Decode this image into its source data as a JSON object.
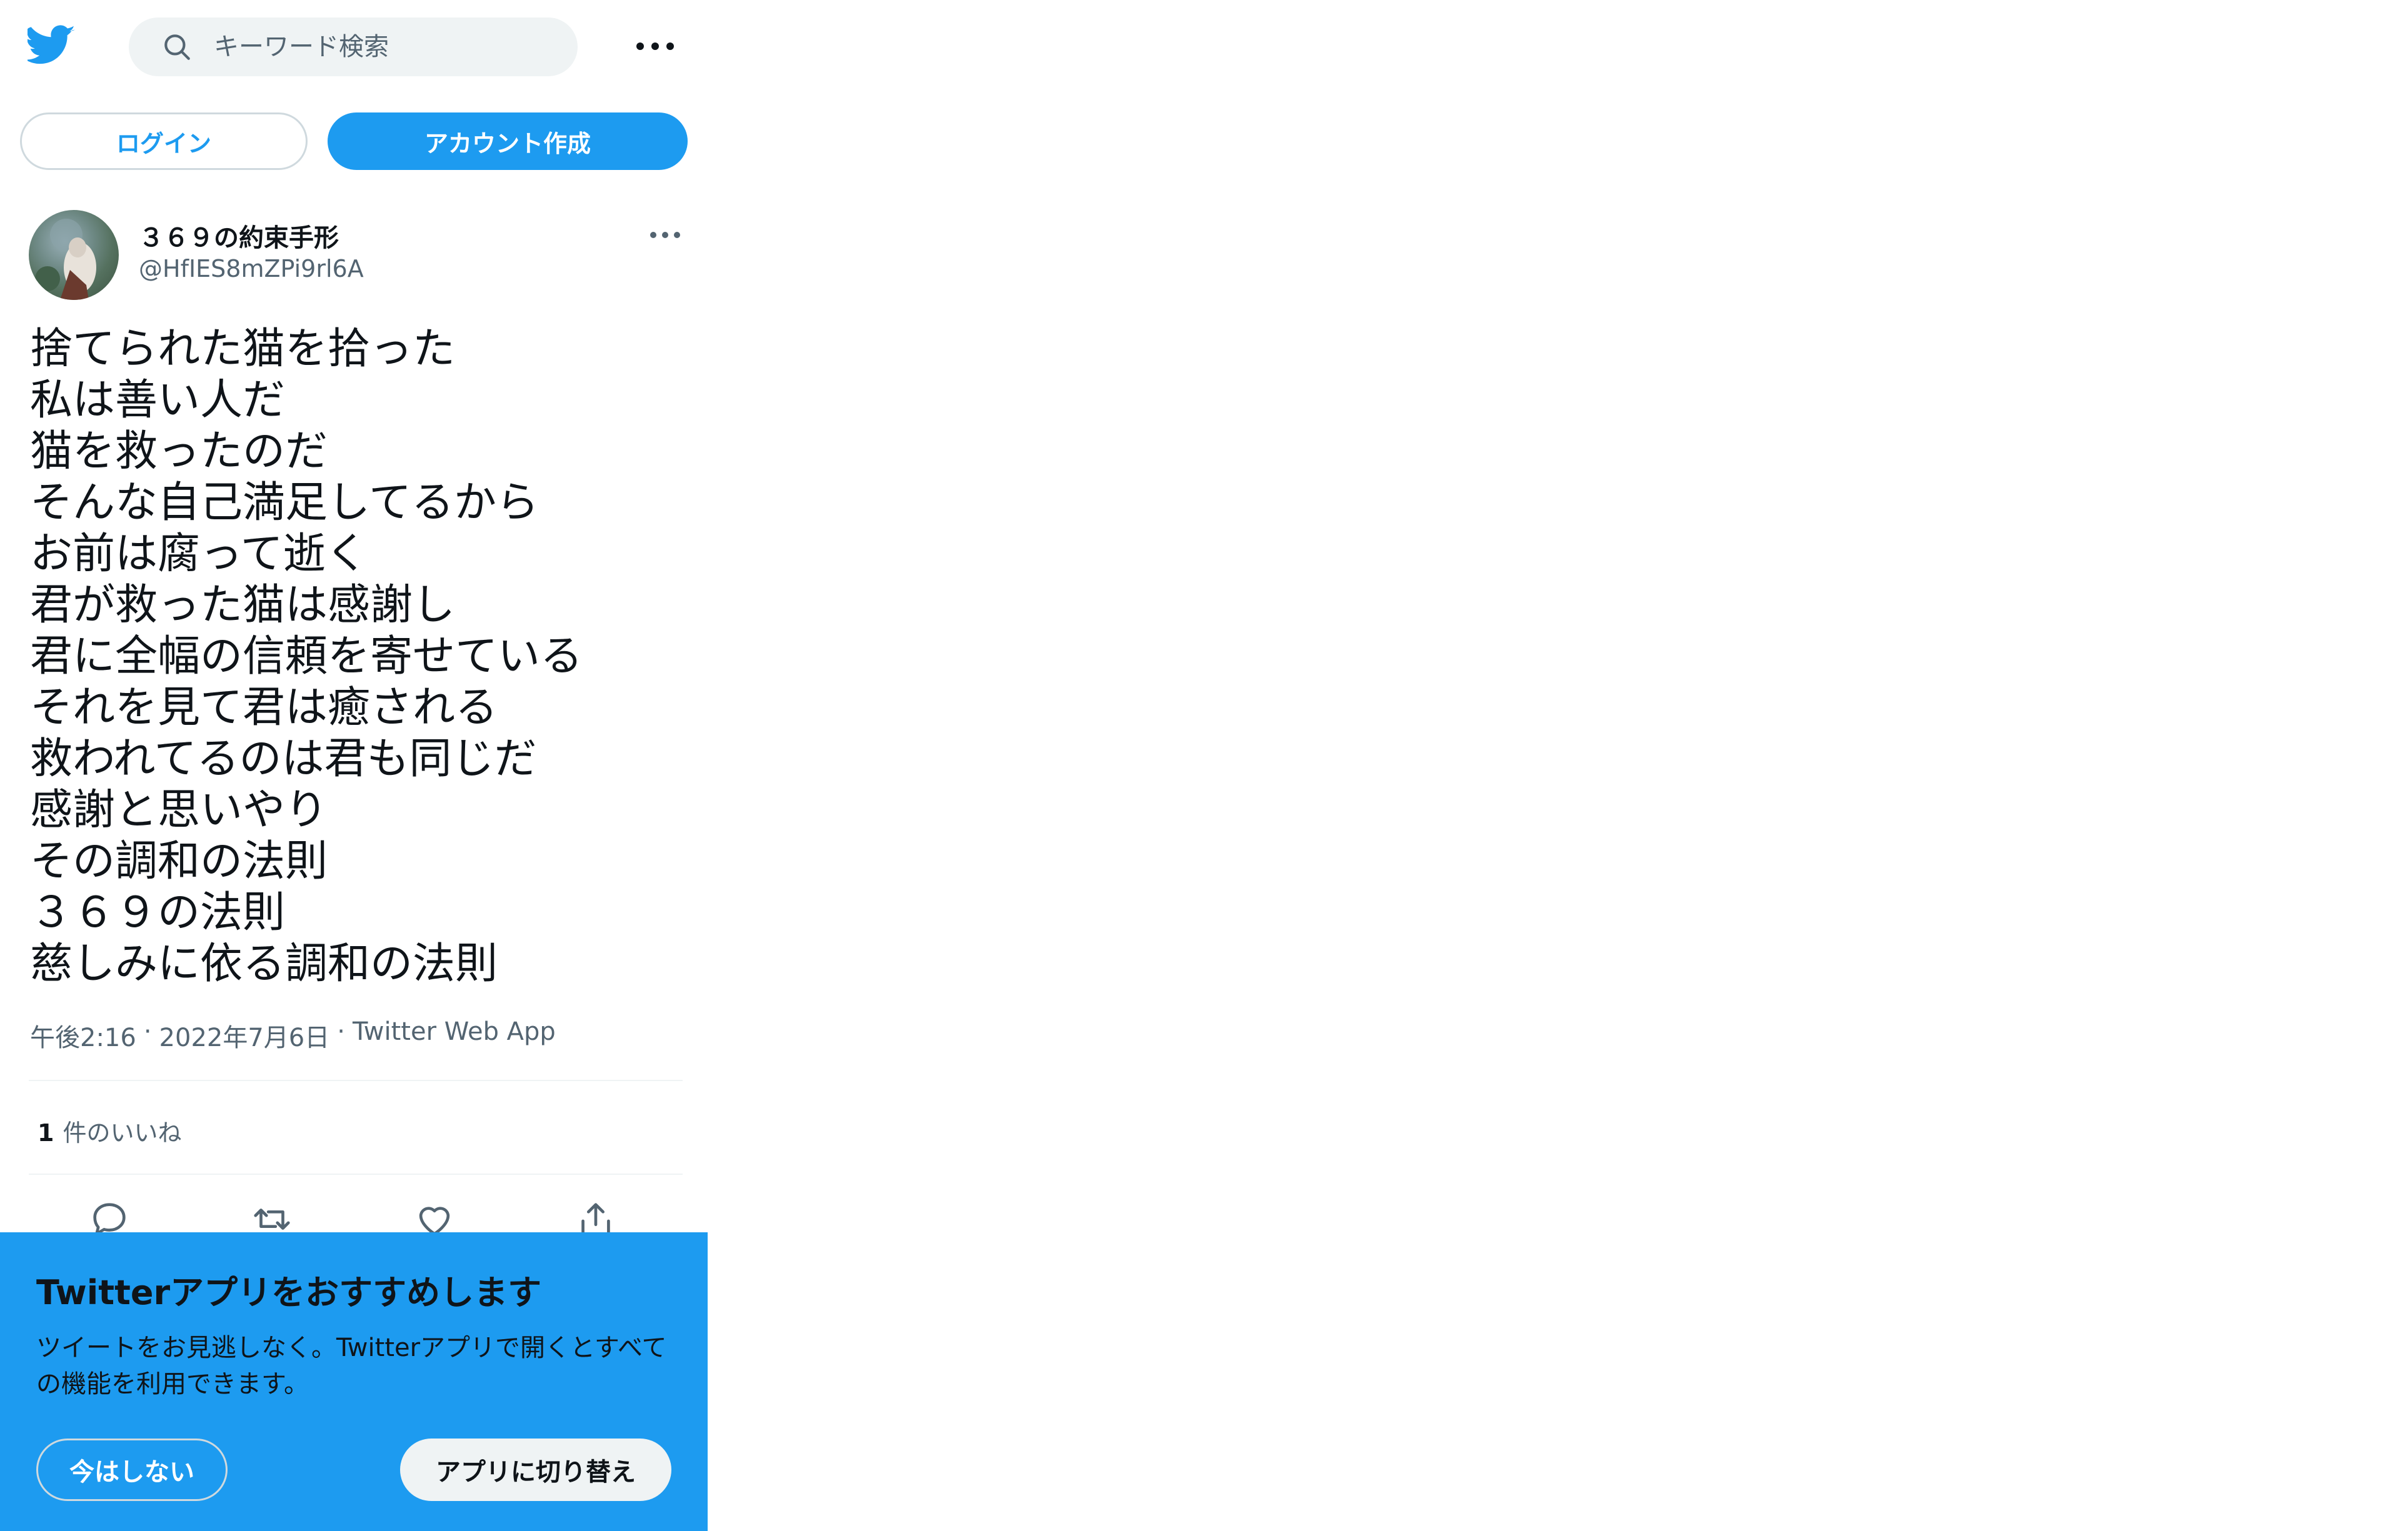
{
  "header": {
    "search_placeholder": "キーワード検索"
  },
  "auth": {
    "login_label": "ログイン",
    "signup_label": "アカウント作成"
  },
  "tweet": {
    "author_name": "３６９の約束手形",
    "author_handle": "@HfIES8mZPi9rl6A",
    "lines": [
      "捨てられた猫を拾った",
      "私は善い人だ",
      "猫を救ったのだ",
      "そんな自己満足してるから",
      "お前は腐って逝く",
      "君が救った猫は感謝し",
      "君に全幅の信頼を寄せている",
      "それを見て君は癒される",
      "救われてるのは君も同じだ",
      "感謝と思いやり",
      "その調和の法則",
      "３６９の法則",
      "慈しみに依る調和の法則"
    ],
    "time": "午後2:16",
    "date": "2022年7月6日",
    "source": "Twitter Web App",
    "separator": "·",
    "like_count": "1",
    "like_label": "件のいいね"
  },
  "banner": {
    "title": "Twitterアプリをおすすめします",
    "text": "ツイートをお見逃しなく。Twitterアプリで開くとすべての機能を利用できます。",
    "dismiss_label": "今はしない",
    "switch_label": "アプリに切り替え"
  },
  "colors": {
    "accent": "#1d9bf0",
    "text_secondary": "#536471",
    "search_bg": "#eff3f4"
  },
  "icons": {
    "logo": "twitter-bird-icon",
    "search": "search-icon",
    "more": "more-icon",
    "reply": "reply-icon",
    "retweet": "retweet-icon",
    "like": "heart-icon",
    "share": "share-icon"
  }
}
